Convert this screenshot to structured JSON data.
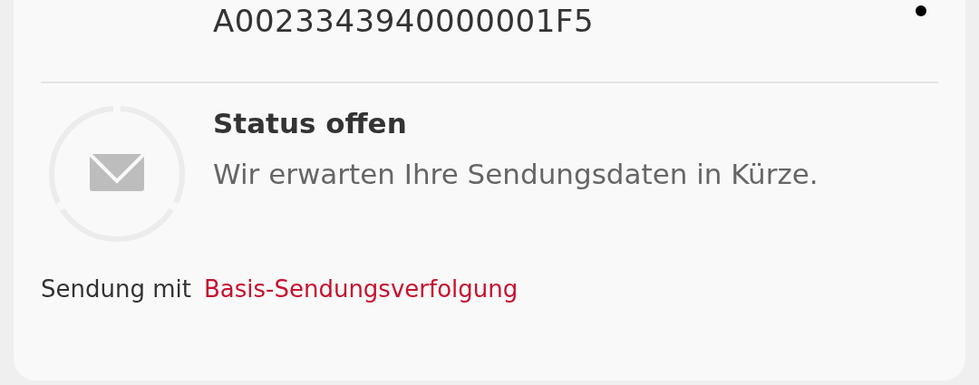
{
  "shipment": {
    "tracking_number": "A0023343940000001F5"
  },
  "status": {
    "title": "Status offen",
    "description": "Wir erwarten Ihre Sendungsdaten in Kürze."
  },
  "footer": {
    "prefix": "Sendung mit",
    "link": "Basis-Sendungsverfolgung"
  }
}
